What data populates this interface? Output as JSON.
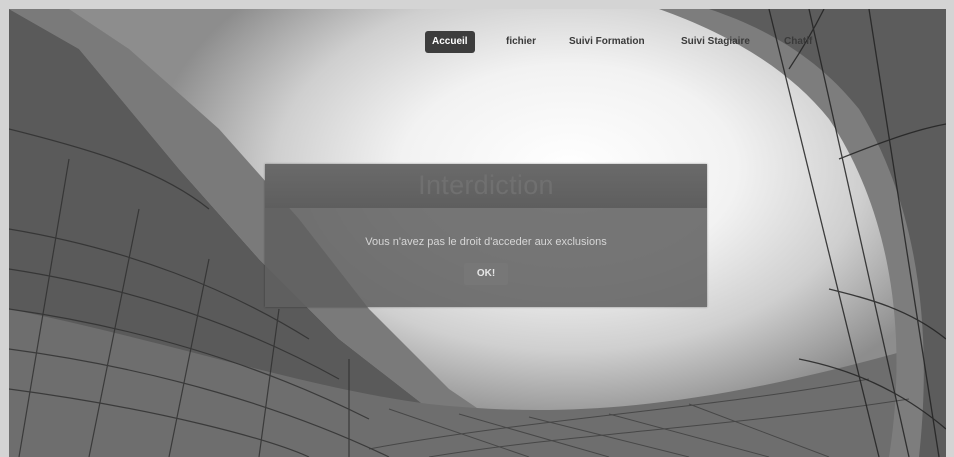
{
  "nav": {
    "items": [
      {
        "label": "Accueil",
        "active": true
      },
      {
        "label": "fichier",
        "active": false
      },
      {
        "label": "Suivi Formation",
        "active": false
      },
      {
        "label": "Suivi Stagiaire",
        "active": false
      },
      {
        "label": "Chatif",
        "active": false
      }
    ]
  },
  "dialog": {
    "title": "Interdiction",
    "message": "Vous n'avez pas le droit d'acceder aux exclusions",
    "ok_label": "OK!"
  },
  "colors": {
    "active_nav_bg": "#3d3d3d",
    "dialog_bg": "#606060",
    "ok_button_bg": "#777777"
  }
}
